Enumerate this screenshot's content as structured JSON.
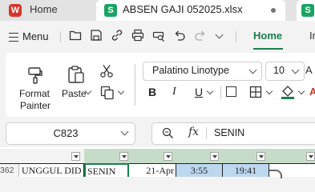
{
  "tabs": {
    "home_label": "Home",
    "doc_label": "ABSEN GAJI 052025.xlsx"
  },
  "menu": {
    "menu_label": "Menu",
    "active_tab": "Home",
    "next_tab": "In"
  },
  "ribbon": {
    "format_painter_line1": "Format",
    "format_painter_line2": "Painter",
    "paste_label": "Paste",
    "font_name": "Palatino Linotype",
    "font_size": "10",
    "bold": "B",
    "italic": "I",
    "underline": "U"
  },
  "formula_bar": {
    "cell_ref": "C823",
    "fx": "fx",
    "value": "SENIN"
  },
  "sheet": {
    "row_number": "362",
    "cells": [
      "UNGGUL DID",
      "SENIN",
      "21-Apr",
      "3:55",
      "19:41"
    ]
  },
  "colors": {
    "accent": "#1a7f4b",
    "wps_red": "#d9342b",
    "sheet_green": "#1ba363",
    "selected_col_band": "#c6dcc8",
    "selected_cell_blue": "#bdd7ee"
  },
  "icons": [
    "wps-logo-icon",
    "spreadsheet-logo-icon",
    "hamburger-icon",
    "open-folder-icon",
    "save-icon",
    "link-icon",
    "print-icon",
    "print-preview-icon",
    "undo-icon",
    "redo-icon",
    "dropdown-icon",
    "format-painter-icon",
    "paste-icon",
    "cut-icon",
    "copy-icon",
    "border-icon",
    "fill-color-icon",
    "search-icon",
    "filter-icon"
  ]
}
